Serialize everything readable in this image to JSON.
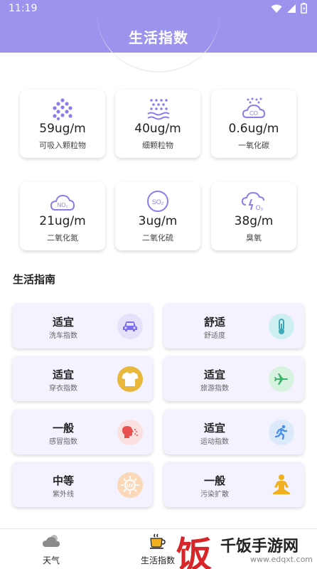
{
  "status_bar": {
    "time": "11:19"
  },
  "app_bar": {
    "title": "生活指数"
  },
  "air_quality": [
    {
      "value": "59ug/m",
      "label": "可吸入颗粒物",
      "icon": "pm10-dots-icon"
    },
    {
      "value": "40ug/m",
      "label": "细颗粒物",
      "icon": "pm25-dots-icon"
    },
    {
      "value": "0.6ug/m",
      "label": "一氧化碳",
      "icon": "co-cloud-icon",
      "badge": "CO"
    },
    {
      "value": "21ug/m",
      "label": "二氧化氮",
      "icon": "no2-cloud-icon",
      "badge": "NO₂"
    },
    {
      "value": "3ug/m",
      "label": "二氧化硫",
      "icon": "so2-circle-icon",
      "badge": "SO₂"
    },
    {
      "value": "38g/m",
      "label": "臭氧",
      "icon": "ozone-cloud-icon",
      "badge": "O₃"
    }
  ],
  "guide": {
    "title": "生活指南",
    "items": [
      {
        "level": "适宜",
        "name": "洗车指数",
        "icon": "car-icon",
        "color": "#7b6ff0"
      },
      {
        "level": "舒适",
        "name": "舒适度",
        "icon": "thermometer-icon",
        "color": "#3fa8b8"
      },
      {
        "level": "适宜",
        "name": "穿衣指数",
        "icon": "tshirt-icon",
        "color": "#e8b73c"
      },
      {
        "level": "适宜",
        "name": "旅游指数",
        "icon": "airplane-icon",
        "color": "#3bb36a"
      },
      {
        "level": "一般",
        "name": "感冒指数",
        "icon": "sneeze-icon",
        "color": "#e8514f"
      },
      {
        "level": "适宜",
        "name": "运动指数",
        "icon": "runner-icon",
        "color": "#4a90e8"
      },
      {
        "level": "中等",
        "name": "紫外线",
        "icon": "uv-sun-icon",
        "color": "#f0a050"
      },
      {
        "level": "一般",
        "name": "污染扩散",
        "icon": "meditation-icon",
        "color": "#f0b020"
      }
    ]
  },
  "bottom_nav": [
    {
      "label": "天气",
      "icon": "cloud-icon"
    },
    {
      "label": "生活指数",
      "icon": "coffee-cup-icon"
    }
  ],
  "watermark": {
    "glyph": "饭",
    "text": "千饭手游网",
    "url": "www.edqxt.com"
  }
}
